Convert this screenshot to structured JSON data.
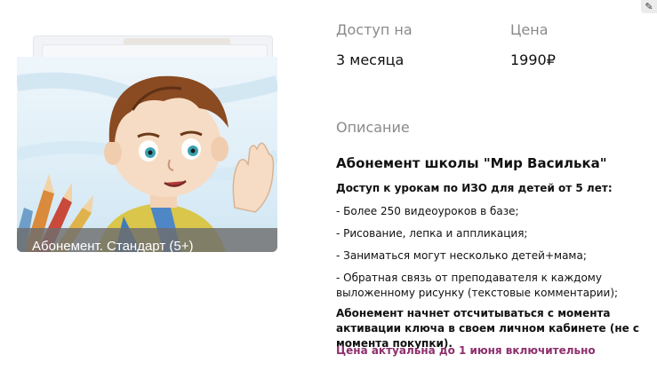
{
  "product": {
    "caption": "Абонемент. Стандарт (5+)"
  },
  "access": {
    "label": "Доступ на",
    "value": "3 месяца"
  },
  "price": {
    "label": "Цена",
    "value": "1990₽"
  },
  "description": {
    "label": "Описание",
    "title": "Абонемент школы \"Мир Василька\"",
    "intro": "Доступ к урокам по ИЗО для детей от 5 лет:",
    "items": [
      "- Более 250 видеоуроков в базе;",
      "- Рисование, лепка и аппликация;",
      "- Заниматься могут несколько детей+мама;",
      "- Обратная связь от преподавателя к каждому выложенному рисунку (текстовые комментарии);"
    ],
    "activation_note": "Абонемент начнет отсчитываться с момента активации ключа в своем личном кабинете (не с момента покупки).",
    "price_note": "Цена актуальна до 1 июня включительно"
  },
  "colors": {
    "accent": "#8e2f6e",
    "label_gray": "#8a8a8a"
  },
  "icons": {
    "corner": "pencil-icon"
  }
}
